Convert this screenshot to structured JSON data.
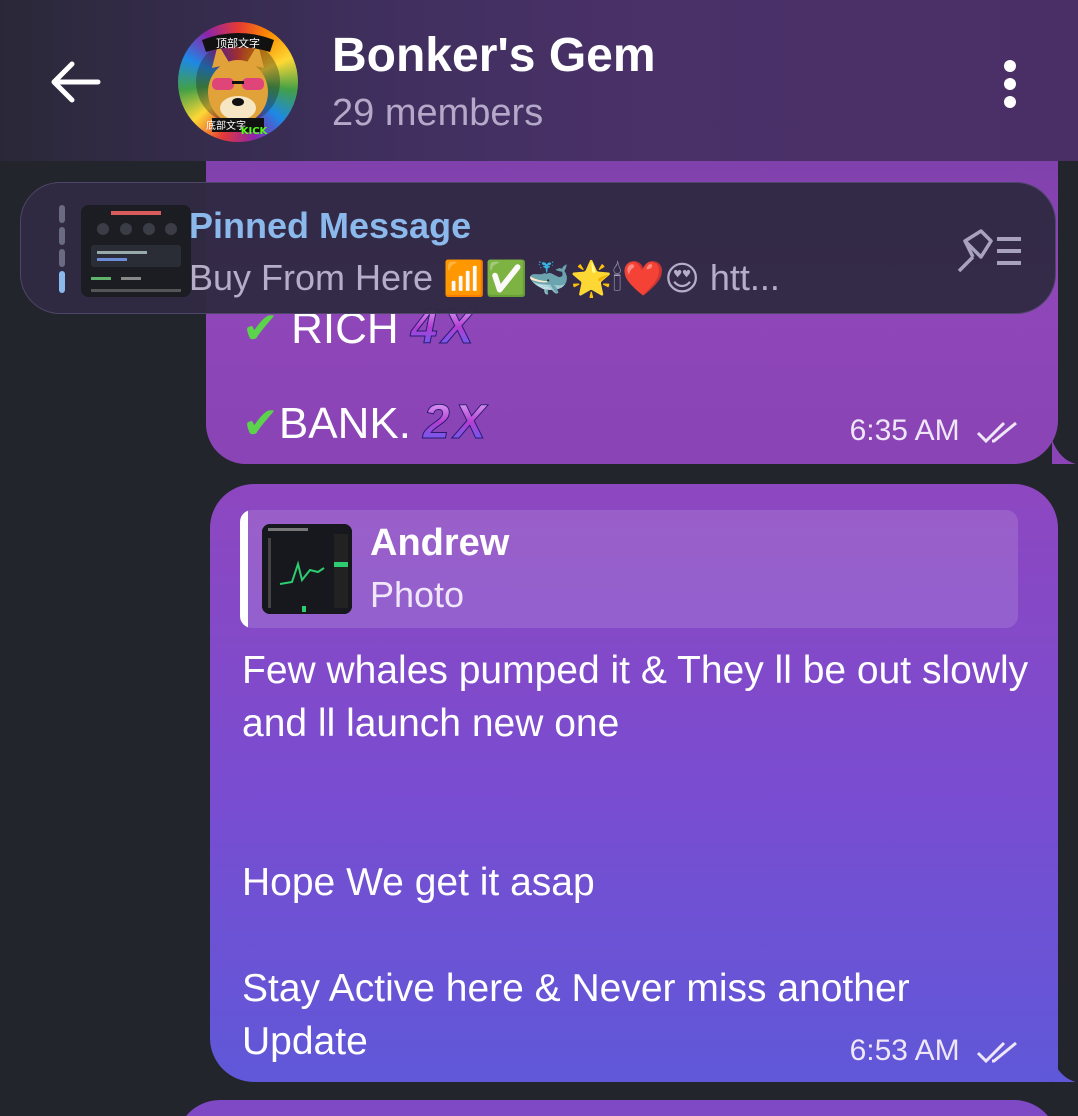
{
  "header": {
    "title": "Bonker's Gem",
    "subtitle": "29 members",
    "avatar_top_text": "顶部文字",
    "avatar_bottom_text": "底部文字",
    "avatar_kick": "KICK"
  },
  "pinned": {
    "title": "Pinned Message",
    "text_prefix": "Buy From Here",
    "text_emoji": "📶✅🐳🌟🕯❤️😍",
    "text_suffix": "htt..."
  },
  "messages": [
    {
      "line_rich": "RICH",
      "line_rich_mult": "4X",
      "line_bank": "BANK.",
      "line_bank_mult": "2X",
      "time": "6:35 AM"
    },
    {
      "reply_name": "Andrew",
      "reply_type": "Photo",
      "body": "Few whales pumped it & They ll be out slowly and ll launch new one\n\n\nHope We get it asap\n\nStay Active here & Never miss another Update",
      "time": "6:53 AM"
    }
  ],
  "colors": {
    "accent_link": "#8bb9ec",
    "bubble_purple": "#8a44b6",
    "background": "#22252b"
  }
}
